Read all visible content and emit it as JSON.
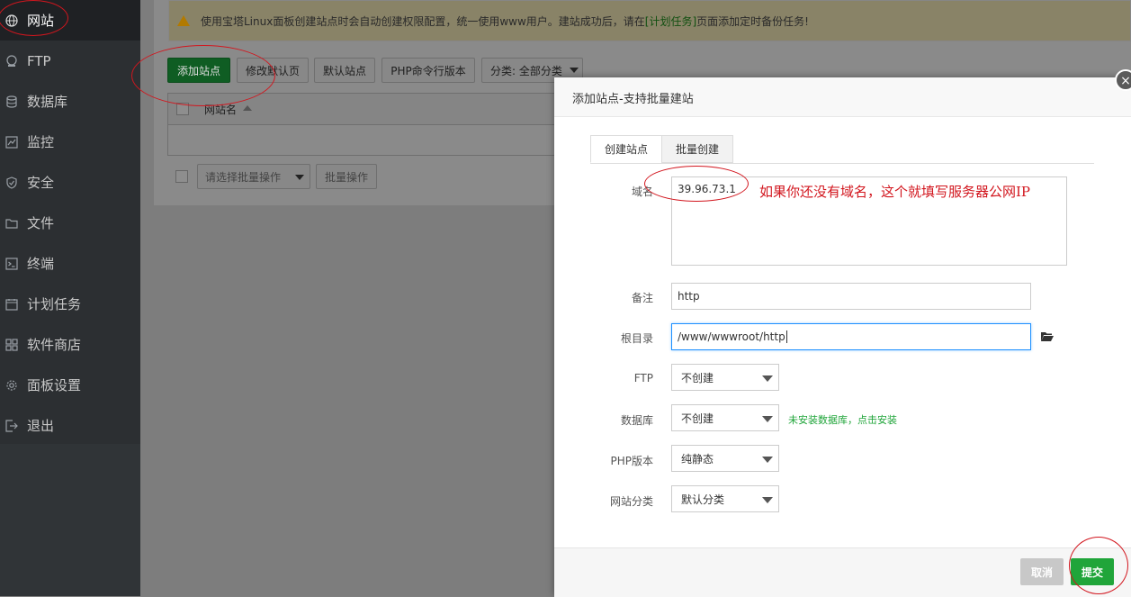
{
  "sidebar": {
    "items": [
      {
        "label": "网站",
        "icon": "globe-icon"
      },
      {
        "label": "FTP",
        "icon": "ftp-icon"
      },
      {
        "label": "数据库",
        "icon": "database-icon"
      },
      {
        "label": "监控",
        "icon": "monitor-icon"
      },
      {
        "label": "安全",
        "icon": "shield-icon"
      },
      {
        "label": "文件",
        "icon": "folder-icon"
      },
      {
        "label": "终端",
        "icon": "terminal-icon"
      },
      {
        "label": "计划任务",
        "icon": "calendar-icon"
      },
      {
        "label": "软件商店",
        "icon": "grid-icon"
      },
      {
        "label": "面板设置",
        "icon": "gear-icon"
      },
      {
        "label": "退出",
        "icon": "logout-icon"
      }
    ]
  },
  "notice": {
    "text_before": "使用宝塔Linux面板创建站点时会自动创建权限配置，统一使用www用户。建站成功后，请在",
    "link": "[计划任务]",
    "text_after": "页面添加定时备份任务!"
  },
  "toolbar": {
    "add_site": "添加站点",
    "modify_default_page": "修改默认页",
    "default_site": "默认站点",
    "php_cli_version": "PHP命令行版本",
    "category": "分类: 全部分类"
  },
  "table": {
    "column_site_name": "网站名"
  },
  "batch": {
    "select_placeholder": "请选择批量操作",
    "button": "批量操作"
  },
  "modal": {
    "title": "添加站点-支持批量建站",
    "tabs": [
      "创建站点",
      "批量创建"
    ],
    "fields": {
      "domain_label": "域名",
      "domain_value": "39.96.73.1",
      "domain_annotation": "如果你还没有域名，这个就填写服务器公网IP",
      "remark_label": "备注",
      "remark_value": "http",
      "root_label": "根目录",
      "root_value": "/www/wwwroot/http",
      "ftp_label": "FTP",
      "ftp_value": "不创建",
      "db_label": "数据库",
      "db_value": "不创建",
      "db_hint": "未安装数据库，点击安装",
      "php_label": "PHP版本",
      "php_value": "纯静态",
      "category_label": "网站分类",
      "category_value": "默认分类"
    },
    "cancel": "取消",
    "submit": "提交",
    "close_glyph": "×",
    "folder_icon": "folder-open-icon"
  },
  "colors": {
    "accent_green": "#20a53a",
    "annotation_red": "#d2161e",
    "sidebar_bg": "#2c2f32"
  }
}
